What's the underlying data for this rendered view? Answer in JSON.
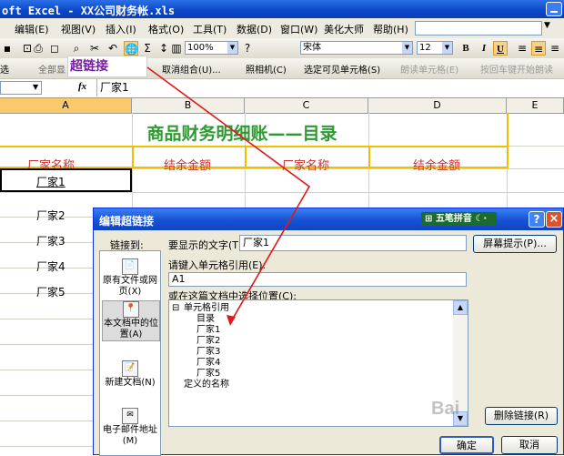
{
  "window": {
    "title": "oft Excel - XX公司财务帐.xls"
  },
  "menu": [
    "编辑(E)",
    "视图(V)",
    "插入(I)",
    "格式(O)",
    "工具(T)",
    "数据(D)",
    "窗口(W)",
    "美化大师",
    "帮助(H)"
  ],
  "toolbar": {
    "zoom": "100%",
    "font": "宋体",
    "size": "12",
    "bold": "B",
    "italic": "I",
    "underline": "U"
  },
  "toolbar2": {
    "partial_left": "选",
    "whole_display": "全部显",
    "ungroup": "取消组合(U)...",
    "camera": "照相机(C)",
    "select_visible": "选定可见单元格(S)",
    "read_cell": "朗读单元格(E)",
    "read_enter": "按回车键开始朗读"
  },
  "tooltip": {
    "label": "超链接"
  },
  "formula_bar": {
    "fx": "fx",
    "value": "厂家1"
  },
  "columns": [
    "A",
    "B",
    "C",
    "D",
    "E"
  ],
  "sheet": {
    "title": "商品财务明细账——目录",
    "headers": [
      "厂家名称",
      "结余金额",
      "厂家名称",
      "结余金额"
    ],
    "rows": [
      "厂家1",
      "厂家2",
      "厂家3",
      "厂家4",
      "厂家5"
    ]
  },
  "dialog": {
    "title": "编辑超链接",
    "ime": "五笔拼音",
    "help": "?",
    "close": "×",
    "link_to": "链接到:",
    "display_label": "要显示的文字(T):",
    "display_value": "厂家1",
    "screentip": "屏幕提示(P)...",
    "cellref_label": "请键入单元格引用(E):",
    "cellref_value": "A1",
    "place_label": "或在这篇文档中选择位置(C):",
    "link_items": [
      {
        "icon": "📄",
        "label": "原有文件或网页(X)"
      },
      {
        "icon": "📍",
        "label": "本文档中的位置(A)"
      },
      {
        "icon": "📝",
        "label": "新建文档(N)"
      },
      {
        "icon": "✉",
        "label": "电子邮件地址(M)"
      }
    ],
    "tree": {
      "root_toggle": "⊟",
      "root": "单元格引用",
      "children": [
        "目录",
        "厂家1",
        "厂家2",
        "厂家3",
        "厂家4",
        "厂家5"
      ],
      "defined_names": "定义的名称"
    },
    "remove_link": "删除链接(R)",
    "ok": "确定",
    "cancel": "取消"
  },
  "watermark": "Bai"
}
